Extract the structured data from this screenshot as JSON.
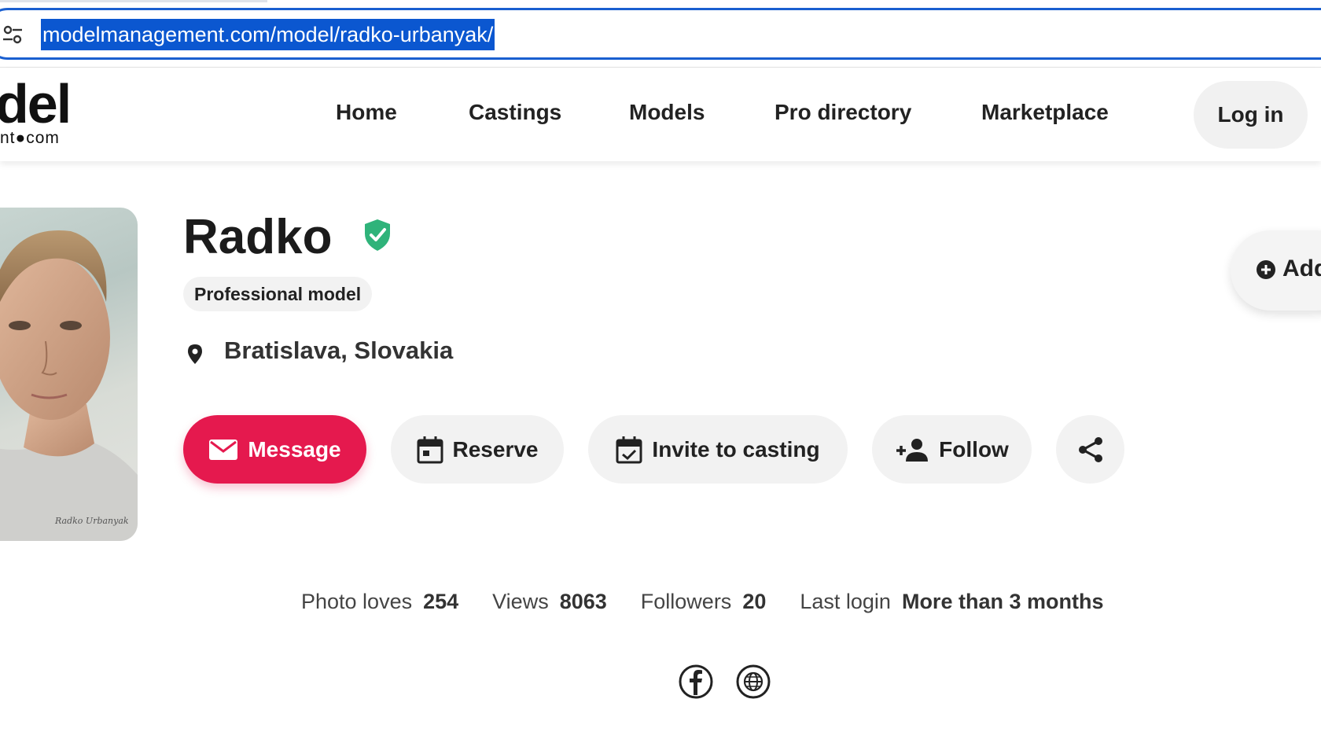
{
  "browser": {
    "url": "modelmanagement.com/model/radko-urbanyak/",
    "icons": {
      "site_info": "tune-icon"
    }
  },
  "header": {
    "logo_main": "del",
    "logo_sub": "nt●com",
    "nav": [
      {
        "label": "Home"
      },
      {
        "label": "Castings"
      },
      {
        "label": "Models"
      },
      {
        "label": "Pro directory"
      },
      {
        "label": "Marketplace"
      }
    ],
    "login_label": "Log in"
  },
  "profile": {
    "name": "Radko",
    "verified": true,
    "role": "Professional model",
    "location": "Bratislava, Slovakia",
    "add_label": "Add",
    "actions": {
      "message": "Message",
      "reserve": "Reserve",
      "invite": "Invite to casting",
      "follow": "Follow"
    },
    "photo_signature": "Radko Urbanyak"
  },
  "stats": {
    "photo_loves_label": "Photo loves",
    "photo_loves": "254",
    "views_label": "Views",
    "views": "8063",
    "followers_label": "Followers",
    "followers": "20",
    "last_login_label": "Last login",
    "last_login": "More than 3 months"
  },
  "social": [
    "facebook-icon",
    "globe-icon"
  ],
  "colors": {
    "accent": "#e5194e",
    "verified": "#2fb37a",
    "url_highlight": "#0b57d0",
    "omnibox_border": "#1a5fd0"
  }
}
